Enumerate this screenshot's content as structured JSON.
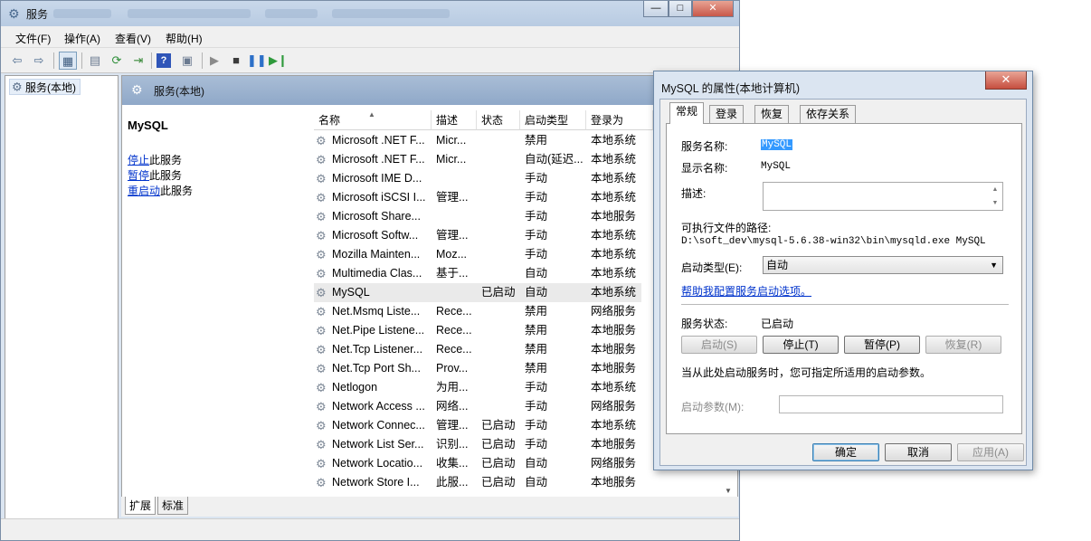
{
  "window": {
    "title": "服务",
    "caption": {
      "minimize": "—",
      "maximize": "□",
      "close": "✕"
    }
  },
  "menubar": [
    "文件(F)",
    "操作(A)",
    "查看(V)",
    "帮助(H)"
  ],
  "toolbar": {
    "icons": [
      "back-arrow-icon",
      "forward-arrow-icon",
      "console-tree-icon",
      "properties-icon",
      "refresh-icon",
      "export-icon",
      "help-icon",
      "show-pane-icon",
      "start-service-icon",
      "stop-service-icon",
      "pause-service-icon",
      "resume-service-icon"
    ]
  },
  "tree": {
    "item": "服务(本地)"
  },
  "pane": {
    "header": "服务(本地)",
    "detail": {
      "service": "MySQL",
      "stop_link": "停止",
      "stop_suffix": "此服务",
      "pause_link": "暂停",
      "pause_suffix": "此服务",
      "restart_link": "重启动",
      "restart_suffix": "此服务"
    }
  },
  "columns": [
    "名称",
    "描述",
    "状态",
    "启动类型",
    "登录为"
  ],
  "services": [
    {
      "name": "Microsoft .NET F...",
      "desc": "Micr...",
      "status": "",
      "startup": "禁用",
      "logon": "本地系统"
    },
    {
      "name": "Microsoft .NET F...",
      "desc": "Micr...",
      "status": "",
      "startup": "自动(延迟...",
      "logon": "本地系统"
    },
    {
      "name": "Microsoft IME D...",
      "desc": "",
      "status": "",
      "startup": "手动",
      "logon": "本地系统"
    },
    {
      "name": "Microsoft iSCSI I...",
      "desc": "管理...",
      "status": "",
      "startup": "手动",
      "logon": "本地系统"
    },
    {
      "name": "Microsoft Share...",
      "desc": "",
      "status": "",
      "startup": "手动",
      "logon": "本地服务"
    },
    {
      "name": "Microsoft Softw...",
      "desc": "管理...",
      "status": "",
      "startup": "手动",
      "logon": "本地系统"
    },
    {
      "name": "Mozilla Mainten...",
      "desc": "Moz...",
      "status": "",
      "startup": "手动",
      "logon": "本地系统"
    },
    {
      "name": "Multimedia Clas...",
      "desc": "基于...",
      "status": "",
      "startup": "自动",
      "logon": "本地系统"
    },
    {
      "name": "MySQL",
      "desc": "",
      "status": "已启动",
      "startup": "自动",
      "logon": "本地系统"
    },
    {
      "name": "Net.Msmq Liste...",
      "desc": "Rece...",
      "status": "",
      "startup": "禁用",
      "logon": "网络服务"
    },
    {
      "name": "Net.Pipe Listene...",
      "desc": "Rece...",
      "status": "",
      "startup": "禁用",
      "logon": "本地服务"
    },
    {
      "name": "Net.Tcp Listener...",
      "desc": "Rece...",
      "status": "",
      "startup": "禁用",
      "logon": "本地服务"
    },
    {
      "name": "Net.Tcp Port Sh...",
      "desc": "Prov...",
      "status": "",
      "startup": "禁用",
      "logon": "本地服务"
    },
    {
      "name": "Netlogon",
      "desc": "为用...",
      "status": "",
      "startup": "手动",
      "logon": "本地系统"
    },
    {
      "name": "Network Access ...",
      "desc": "网络...",
      "status": "",
      "startup": "手动",
      "logon": "网络服务"
    },
    {
      "name": "Network Connec...",
      "desc": "管理...",
      "status": "已启动",
      "startup": "手动",
      "logon": "本地系统"
    },
    {
      "name": "Network List Ser...",
      "desc": "识别...",
      "status": "已启动",
      "startup": "手动",
      "logon": "本地服务"
    },
    {
      "name": "Network Locatio...",
      "desc": "收集...",
      "status": "已启动",
      "startup": "自动",
      "logon": "网络服务"
    },
    {
      "name": "Network Store I...",
      "desc": "此服...",
      "status": "已启动",
      "startup": "自动",
      "logon": "本地服务"
    }
  ],
  "selected_service": "MySQL",
  "bottom_tabs": [
    "扩展",
    "标准"
  ],
  "dialog": {
    "title": "MySQL 的属性(本地计算机)",
    "close": "✕",
    "tabs": [
      "常规",
      "登录",
      "恢复",
      "依存关系"
    ],
    "service_name_label": "服务名称:",
    "service_name": "MySQL",
    "display_name_label": "显示名称:",
    "display_name": "MySQL",
    "description_label": "描述:",
    "path_label": "可执行文件的路径:",
    "path": "D:\\soft_dev\\mysql-5.6.38-win32\\bin\\mysqld.exe MySQL",
    "startup_type_label": "启动类型(E):",
    "startup_type": "自动",
    "help_link": "帮助我配置服务启动选项。",
    "status_label": "服务状态:",
    "status": "已启动",
    "buttons": {
      "start": "启动(S)",
      "stop": "停止(T)",
      "pause": "暂停(P)",
      "resume": "恢复(R)"
    },
    "hint": "当从此处启动服务时，您可指定所适用的启动参数。",
    "params_label": "启动参数(M):",
    "ok": "确定",
    "cancel": "取消",
    "apply": "应用(A)"
  }
}
